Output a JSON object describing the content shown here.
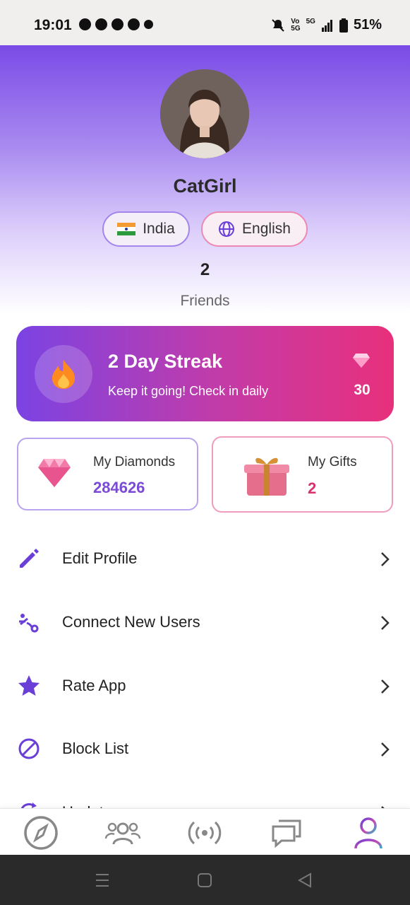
{
  "status_bar": {
    "time": "19:01",
    "volte_top": "Vo",
    "volte_bottom": "5G",
    "network": "5G",
    "battery": "51%"
  },
  "profile": {
    "name": "CatGirl",
    "country": "India",
    "language": "English",
    "friends_count": "2",
    "friends_label": "Friends"
  },
  "streak": {
    "title": "2 Day Streak",
    "subtitle": "Keep it going! Check in daily",
    "reward": "30"
  },
  "wallet": {
    "diamonds_label": "My Diamonds",
    "diamonds_value": "284626",
    "gifts_label": "My Gifts",
    "gifts_value": "2"
  },
  "menu": [
    {
      "label": "Edit Profile",
      "icon": "pencil-icon"
    },
    {
      "label": "Connect New Users",
      "icon": "connect-icon"
    },
    {
      "label": "Rate App",
      "icon": "star-icon"
    },
    {
      "label": "Block List",
      "icon": "block-icon"
    },
    {
      "label": "Update app",
      "icon": "refresh-icon"
    }
  ],
  "bottom_nav": [
    {
      "name": "explore",
      "icon": "compass-icon",
      "active": false
    },
    {
      "name": "friends",
      "icon": "group-icon",
      "active": false
    },
    {
      "name": "live",
      "icon": "broadcast-icon",
      "active": false
    },
    {
      "name": "messages",
      "icon": "chat-icon",
      "active": false
    },
    {
      "name": "profile",
      "icon": "person-icon",
      "active": true
    }
  ],
  "colors": {
    "accent_purple": "#7a4be6",
    "accent_pink": "#e0337f",
    "diamond_value": "#7b4ad6",
    "gift_value": "#d8326f"
  }
}
